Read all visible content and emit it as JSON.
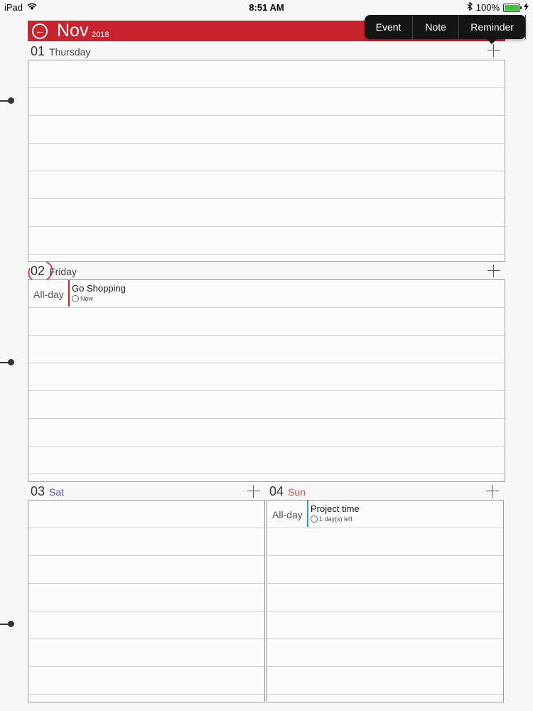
{
  "statusbar": {
    "device": "iPad",
    "time": "8:51 AM",
    "battery": "100%"
  },
  "header": {
    "month": "Nov",
    "year": "2018"
  },
  "popover": {
    "options": [
      "Event",
      "Note",
      "Reminder"
    ]
  },
  "days": [
    {
      "num": "01",
      "name": "Thursday",
      "events": []
    },
    {
      "num": "02",
      "name": "Friday",
      "allday_label": "All-day",
      "events": [
        {
          "title": "Go Shopping",
          "status": "Now",
          "color": "#c9232d"
        }
      ]
    },
    {
      "num": "03",
      "name": "Sat",
      "events": []
    },
    {
      "num": "04",
      "name": "Sun",
      "allday_label": "All-day",
      "events": [
        {
          "title": "Project time",
          "status": "1 day(s) left",
          "color": "#2a9fd0"
        }
      ]
    }
  ],
  "colors": {
    "accent": "#c9232d",
    "saturday": "#5560b0",
    "sunday": "#d9534f"
  }
}
